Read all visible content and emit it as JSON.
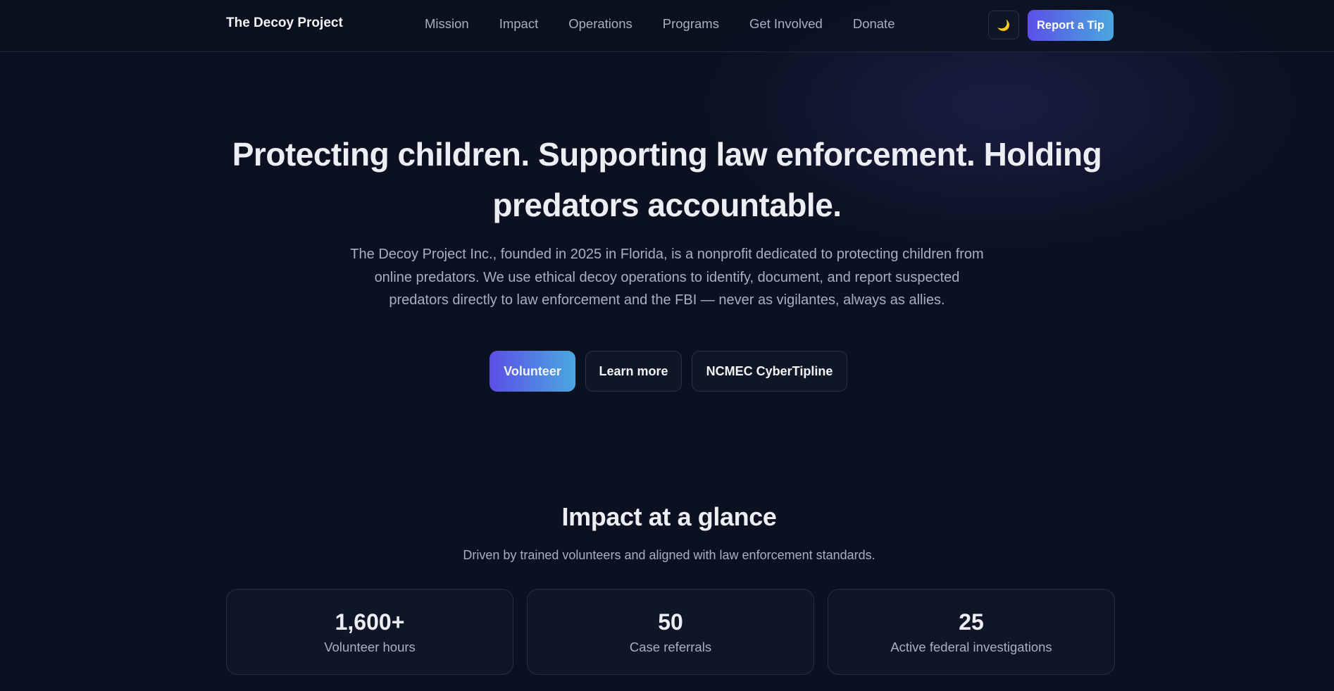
{
  "header": {
    "brand": "The Decoy Project",
    "nav": [
      "Mission",
      "Impact",
      "Operations",
      "Programs",
      "Get Involved",
      "Donate"
    ],
    "theme_toggle_icon": "moon-icon",
    "theme_toggle_glyph": "🌙",
    "report_tip_label": "Report a Tip"
  },
  "hero": {
    "title": "Protecting children. Supporting law enforcement. Holding predators accountable.",
    "description": "The Decoy Project Inc., founded in 2025 in Florida, is a nonprofit dedicated to protecting children from online predators. We use ethical decoy operations to identify, document, and report suspected predators directly to law enforcement and the FBI — never as vigilantes, always as allies.",
    "buttons": {
      "volunteer": "Volunteer",
      "learn_more": "Learn more",
      "ncmec": "NCMEC CyberTipline"
    }
  },
  "impact": {
    "title": "Impact at a glance",
    "subtitle": "Driven by trained volunteers and aligned with law enforcement standards.",
    "stats": [
      {
        "value": "1,600+",
        "label": "Volunteer hours"
      },
      {
        "value": "50",
        "label": "Case referrals"
      },
      {
        "value": "25",
        "label": "Active federal investigations"
      }
    ]
  },
  "colors": {
    "background": "#0b1120",
    "accent_start": "#5b4fe6",
    "accent_end": "#4aa8e0",
    "text_primary": "#eceef3",
    "text_muted": "#a8b0c0"
  }
}
